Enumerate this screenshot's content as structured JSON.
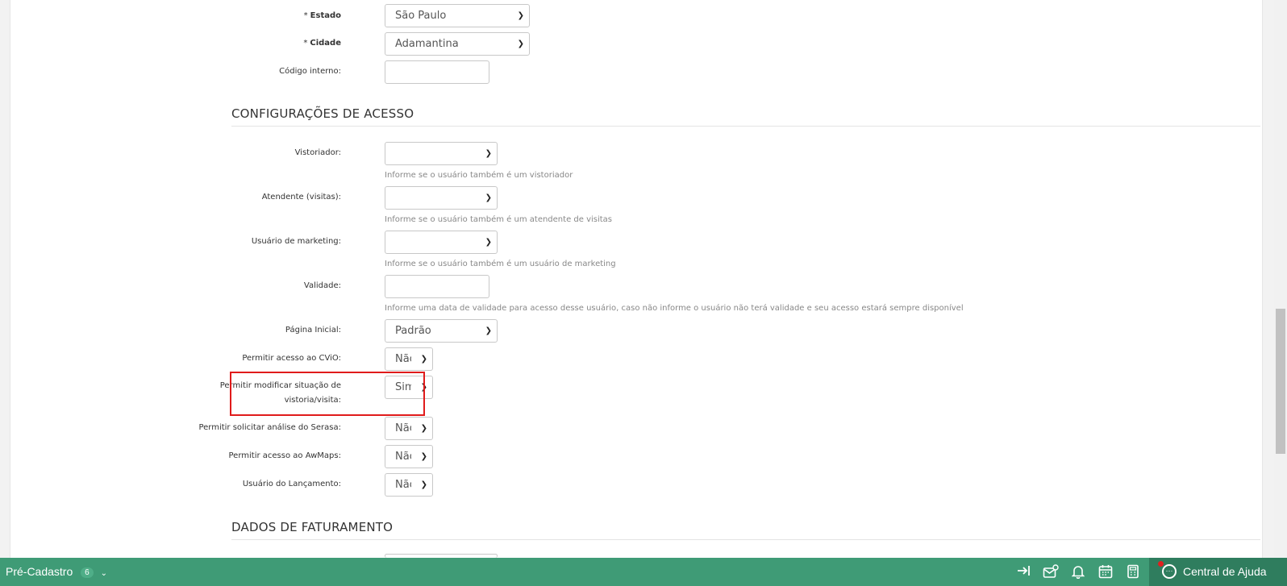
{
  "form": {
    "estado": {
      "label": "Estado",
      "required": "*",
      "value": "São Paulo"
    },
    "cidade": {
      "label": "Cidade",
      "required": "*",
      "value": "Adamantina"
    },
    "codigo_interno": {
      "label": "Código interno:",
      "value": ""
    }
  },
  "acesso": {
    "title": "CONFIGURAÇÕES DE ACESSO",
    "vistoriador": {
      "label": "Vistoriador:",
      "value": "",
      "help": "Informe se o usuário também é um vistoriador"
    },
    "atendente": {
      "label": "Atendente (visitas):",
      "value": "",
      "help": "Informe se o usuário também é um atendente de visitas"
    },
    "marketing": {
      "label": "Usuário de marketing:",
      "value": "",
      "help": "Informe se o usuário também é um usuário de marketing"
    },
    "validade": {
      "label": "Validade:",
      "value": "",
      "help": "Informe uma data de validade para acesso desse usuário, caso não informe o usuário não terá validade e seu acesso estará sempre disponível"
    },
    "pagina_inicial": {
      "label": "Página Inicial:",
      "value": "Padrão"
    },
    "cvio": {
      "label": "Permitir acesso ao CViO:",
      "value": "Não"
    },
    "modificar_situacao": {
      "label_line1": "Permitir modificar situação de",
      "label_line2": "vistoria/visita:",
      "value": "Sim"
    },
    "serasa": {
      "label": "Permitir solicitar análise do Serasa:",
      "value": "Não"
    },
    "awmaps": {
      "label": "Permitir acesso ao AwMaps:",
      "value": "Não"
    },
    "lancamento": {
      "label": "Usuário do Lançamento:",
      "value": "Não"
    }
  },
  "faturamento": {
    "title": "DADOS DE FATURAMENTO"
  },
  "bottombar": {
    "menu_label": "Pré-Cadastro",
    "menu_count": "6",
    "help_label": "Central de Ajuda",
    "icons": [
      "logout-icon",
      "mail-settings-icon",
      "bell-icon",
      "calendar-icon",
      "calculator-icon",
      "chat-icon"
    ]
  },
  "colors": {
    "bar": "#3f9b76",
    "help": "#2f7d5e",
    "highlight": "#e01b1b"
  }
}
